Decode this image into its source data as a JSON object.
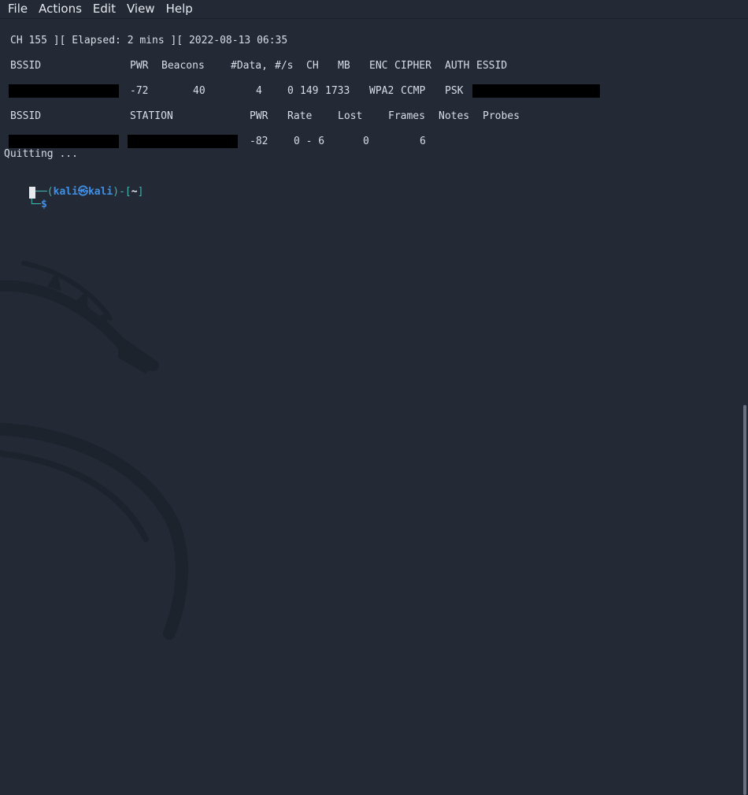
{
  "menubar": {
    "items": [
      "File",
      "Actions",
      "Edit",
      "View",
      "Help"
    ]
  },
  "terminal": {
    "status_line": "CH 155 ][ Elapsed: 2 mins ][ 2022-08-13 06:35",
    "ap_headers": {
      "bssid": "BSSID",
      "pwr": "PWR",
      "beacons": "Beacons",
      "data": "#Data,",
      "per_s": "#/s",
      "ch": "CH",
      "mb": "MB",
      "enc": "ENC",
      "cipher": "CIPHER",
      "auth": "AUTH",
      "essid": "ESSID"
    },
    "ap_row": {
      "pwr": "-72",
      "beacons": "40",
      "data": "4",
      "per_s": "0",
      "ch": "149",
      "mb": "1733",
      "enc": "WPA2",
      "cipher": "CCMP",
      "auth": "PSK"
    },
    "station_headers": {
      "bssid": "BSSID",
      "station": "STATION",
      "pwr": "PWR",
      "rate": "Rate",
      "lost": "Lost",
      "frames": "Frames",
      "notes": "Notes",
      "probes": "Probes"
    },
    "station_row": {
      "pwr": "-82",
      "rate": "0 - 6",
      "lost": "0",
      "frames": "6"
    },
    "quit_message": "Quitting ...",
    "prompt": {
      "top_left": "┌──(",
      "user": "kali",
      "at_symbol": "㉿",
      "host": "kali",
      "mid": ")-[",
      "dir": "~",
      "end": "]",
      "bottom_left": "└─",
      "dollar": "$"
    }
  },
  "colors": {
    "background": "#232a36",
    "prompt_blue": "#3f8fe6",
    "prompt_teal": "#3fb3b0"
  }
}
